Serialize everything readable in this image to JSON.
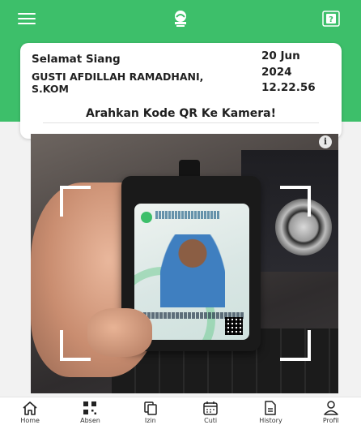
{
  "header": {
    "menu_icon": "hamburger-menu-icon",
    "logo_icon": "company-logo-icon",
    "help_icon": "help-icon",
    "accent_color": "#3dbf6a"
  },
  "info_card": {
    "greeting": "Selamat Siang",
    "user_name": "GUSTI AFDILLAH RAMADHANI, S.KOM",
    "date": "20 Jun 2024",
    "time": "12.22.56",
    "instruction": "Arahkan Kode QR Ke Kamera!"
  },
  "camera": {
    "info_icon": "info-icon",
    "info_glyph": "i",
    "scanner_frame": "qr-scan-frame"
  },
  "bottom_nav": {
    "items": [
      {
        "label": "Home",
        "icon": "home-icon"
      },
      {
        "label": "Absen",
        "icon": "qr-code-icon"
      },
      {
        "label": "Izin",
        "icon": "documents-icon"
      },
      {
        "label": "Cuti",
        "icon": "calendar-icon"
      },
      {
        "label": "History",
        "icon": "document-icon"
      },
      {
        "label": "Profil",
        "icon": "user-icon"
      }
    ]
  }
}
